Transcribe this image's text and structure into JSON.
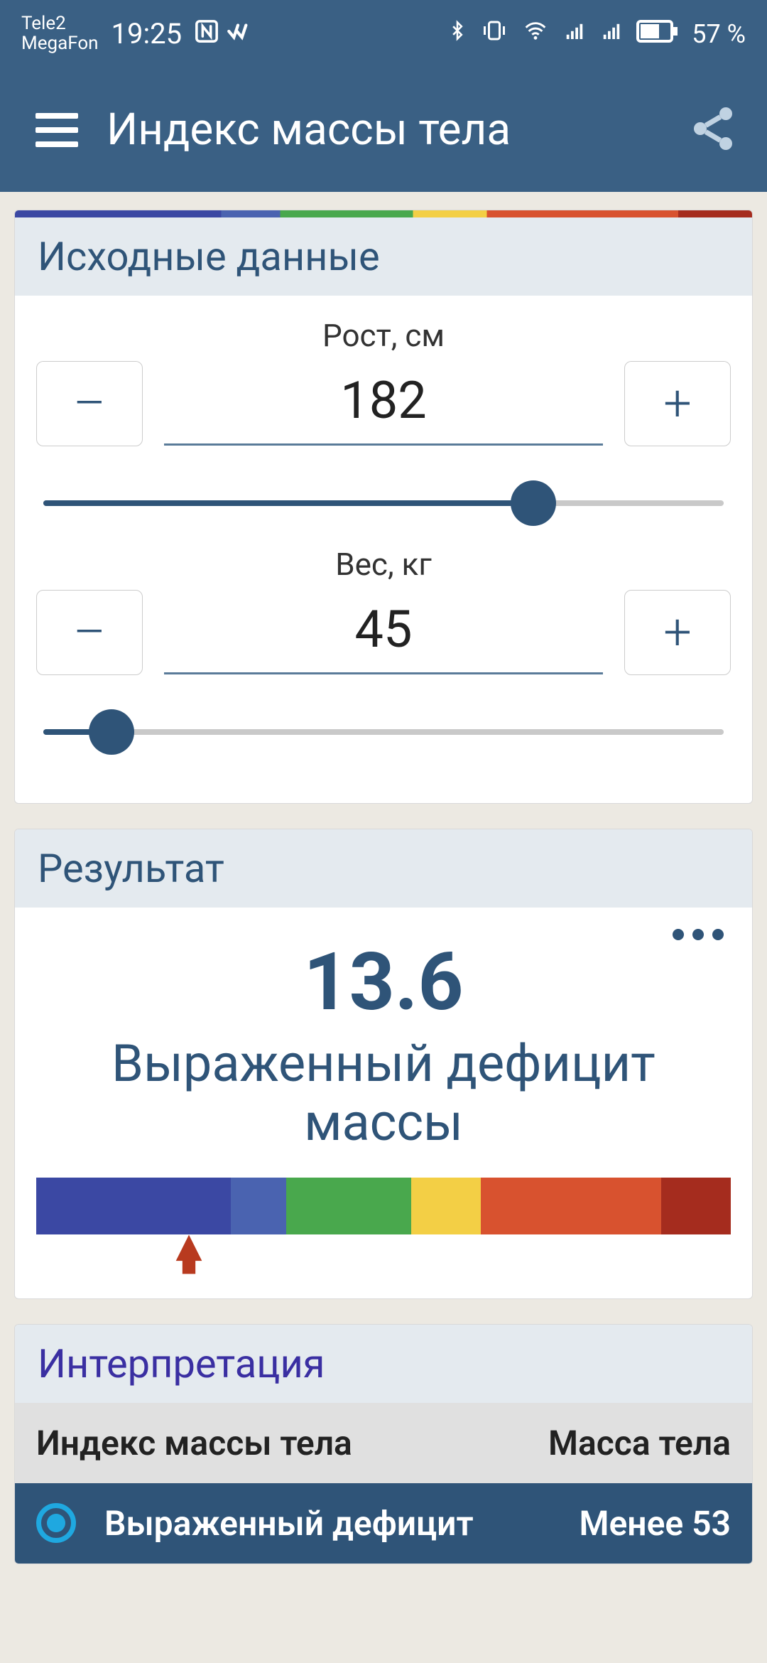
{
  "status": {
    "carrier1": "Tele2",
    "carrier2": "MegaFon",
    "time": "19:25",
    "battery": "57 %"
  },
  "appbar": {
    "title": "Индекс массы тела"
  },
  "input_card": {
    "title": "Исходные данные",
    "height_label": "Рост, см",
    "height_value": "182",
    "height_pct": 72,
    "weight_label": "Вес, кг",
    "weight_value": "45",
    "weight_pct": 10,
    "minus": "–",
    "plus": "+"
  },
  "result_card": {
    "title": "Результат",
    "value": "13.6",
    "label": "Выраженный дефицит массы",
    "pointer_pct": 22,
    "bands": [
      {
        "color": "#3b48a3",
        "w": 28
      },
      {
        "color": "#4a63b0",
        "w": 8
      },
      {
        "color": "#49a84d",
        "w": 18
      },
      {
        "color": "#f3cf45",
        "w": 10
      },
      {
        "color": "#d8522f",
        "w": 26
      },
      {
        "color": "#a52c1e",
        "w": 10
      }
    ]
  },
  "interp_card": {
    "title": "Интерпретация",
    "col1": "Индекс массы тела",
    "col2": "Масса тела",
    "row_label": "Выраженный дефицит",
    "row_value": "Менее 53"
  }
}
